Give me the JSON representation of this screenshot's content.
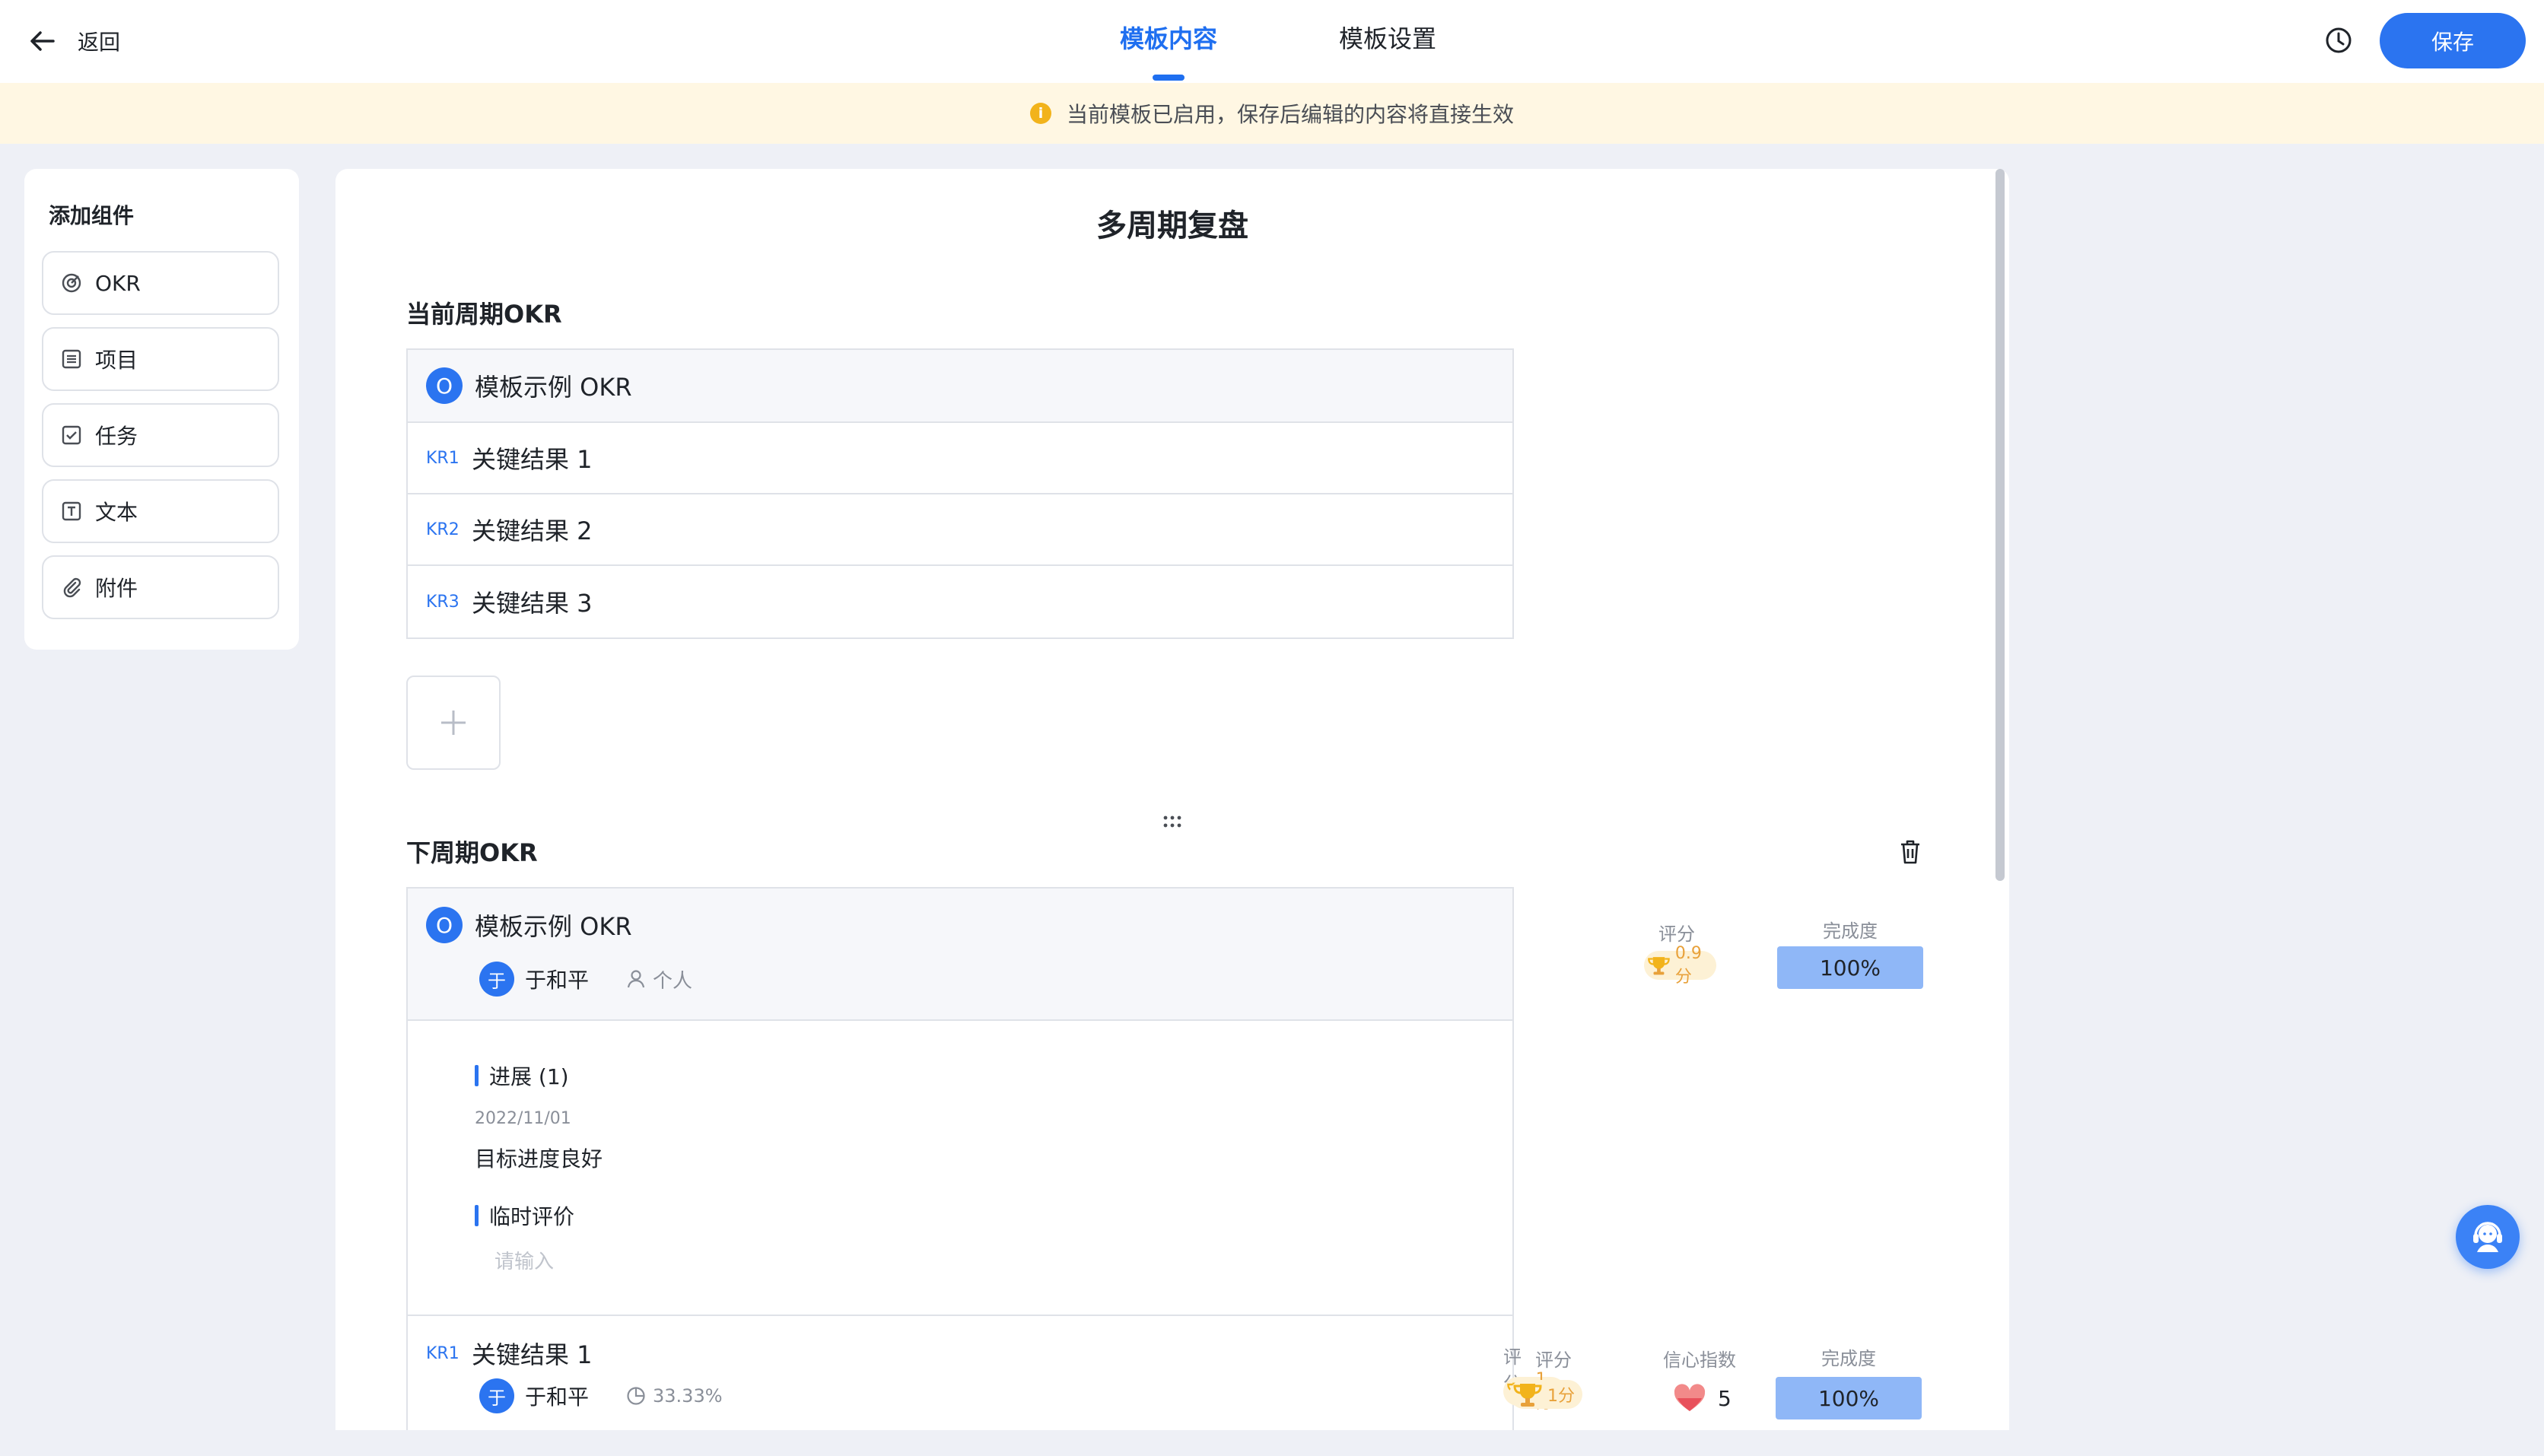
{
  "header": {
    "back_label": "返回",
    "tabs": [
      {
        "label": "模板内容",
        "active": true
      },
      {
        "label": "模板设置",
        "active": false
      }
    ],
    "history_icon": "clock-icon",
    "save_label": "保存"
  },
  "notice": {
    "icon": "info-icon",
    "text": "当前模板已启用，保存后编辑的内容将直接生效"
  },
  "sidebar": {
    "title": "添加组件",
    "items": [
      {
        "label": "OKR",
        "icon": "target-icon"
      },
      {
        "label": "项目",
        "icon": "list-icon"
      },
      {
        "label": "任务",
        "icon": "checkbox-icon"
      },
      {
        "label": "文本",
        "icon": "text-icon"
      },
      {
        "label": "附件",
        "icon": "paperclip-icon"
      }
    ]
  },
  "document": {
    "title": "多周期复盘",
    "current": {
      "title": "当前周期OKR",
      "objective_badge": "O",
      "objective": "模板示例 OKR",
      "key_results": [
        {
          "tag": "KR1",
          "text": "关键结果 1"
        },
        {
          "tag": "KR2",
          "text": "关键结果 2"
        },
        {
          "tag": "KR3",
          "text": "关键结果 3"
        }
      ]
    },
    "next": {
      "title": "下周期OKR",
      "objective_badge": "O",
      "objective": "模板示例 OKR",
      "owner_initial": "于",
      "owner": "于和平",
      "scope": "个人",
      "score_label": "评分",
      "score_value": "0.9分",
      "completion_label": "完成度",
      "completion_value": "100%",
      "progress_title": "进展 (1)",
      "progress_date": "2022/11/01",
      "progress_text": "目标进度良好",
      "eval_title": "临时评价",
      "eval_placeholder": "请输入",
      "kr": {
        "tag": "KR1",
        "text": "关键结果 1",
        "owner_initial": "于",
        "owner": "于和平",
        "progress": "33.33%",
        "score_label": "评分",
        "score_value": "1分",
        "confidence_label": "信心指数",
        "confidence_value": "5",
        "completion_label": "完成度",
        "completion_value": "100%"
      }
    }
  },
  "colors": {
    "accent": "#2b74f0",
    "completion_fill": "#8fb7f7",
    "notice_bg": "#fff7e3",
    "score_bg": "#fdf1d5"
  }
}
